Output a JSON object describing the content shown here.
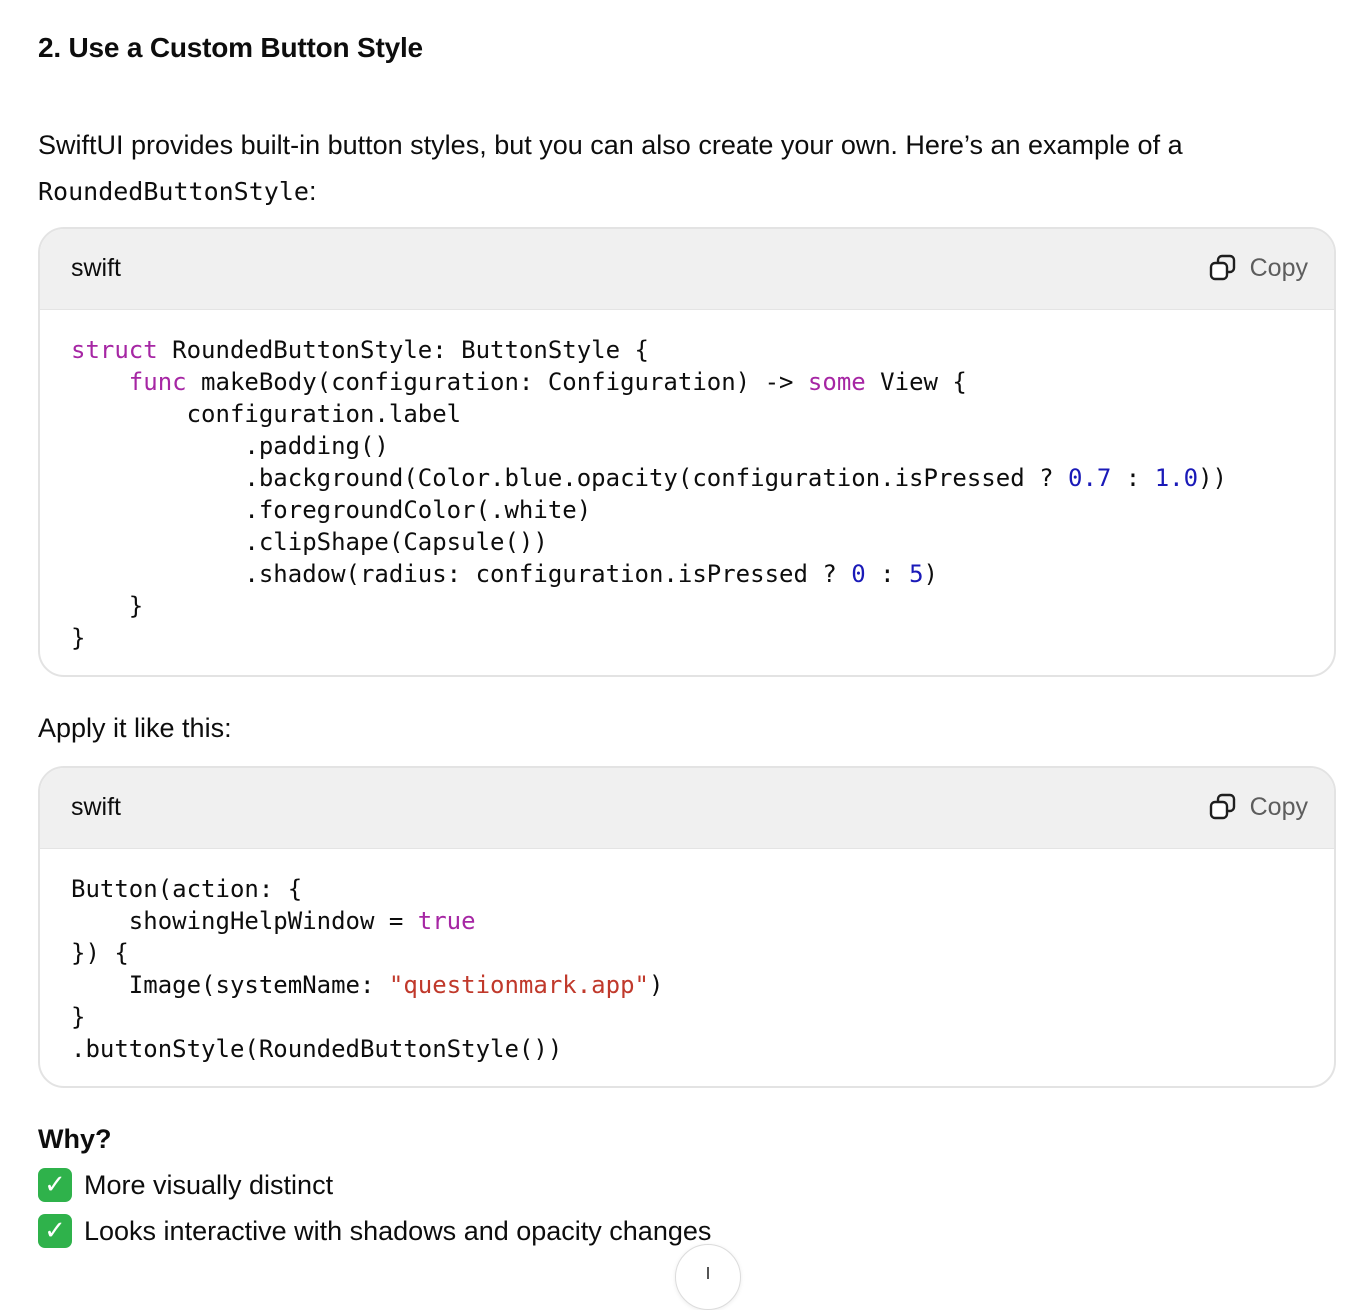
{
  "section": {
    "heading": "2. Use a Custom Button Style",
    "intro_text": "SwiftUI provides built-in button styles, but you can also create your own. Here’s an example of a ",
    "intro_code": "RoundedButtonStyle",
    "intro_suffix": ":"
  },
  "code_blocks": [
    {
      "language": "swift",
      "copy_label": "Copy",
      "lines": [
        [
          {
            "t": "struct",
            "c": "kw"
          },
          {
            "t": " RoundedButtonStyle: ButtonStyle {"
          }
        ],
        [
          {
            "t": "    "
          },
          {
            "t": "func",
            "c": "kw"
          },
          {
            "t": " makeBody(configuration: Configuration) -> "
          },
          {
            "t": "some",
            "c": "kw"
          },
          {
            "t": " View {"
          }
        ],
        [
          {
            "t": "        configuration.label"
          }
        ],
        [
          {
            "t": "            .padding()"
          }
        ],
        [
          {
            "t": "            .background(Color.blue.opacity(configuration.isPressed ? "
          },
          {
            "t": "0.7",
            "c": "num"
          },
          {
            "t": " : "
          },
          {
            "t": "1.0",
            "c": "num"
          },
          {
            "t": "))"
          }
        ],
        [
          {
            "t": "            .foregroundColor(.white)"
          }
        ],
        [
          {
            "t": "            .clipShape(Capsule())"
          }
        ],
        [
          {
            "t": "            .shadow(radius: configuration.isPressed ? "
          },
          {
            "t": "0",
            "c": "num"
          },
          {
            "t": " : "
          },
          {
            "t": "5",
            "c": "num"
          },
          {
            "t": ")"
          }
        ],
        [
          {
            "t": "    }"
          }
        ],
        [
          {
            "t": "}"
          }
        ]
      ]
    },
    {
      "language": "swift",
      "copy_label": "Copy",
      "lines": [
        [
          {
            "t": "Button(action: {"
          }
        ],
        [
          {
            "t": "    showingHelpWindow = "
          },
          {
            "t": "true",
            "c": "kw"
          }
        ],
        [
          {
            "t": "}) {"
          }
        ],
        [
          {
            "t": "    Image(systemName: "
          },
          {
            "t": "\"questionmark.app\"",
            "c": "str"
          },
          {
            "t": ")"
          }
        ],
        [
          {
            "t": "}"
          }
        ],
        [
          {
            "t": ".buttonStyle(RoundedButtonStyle())"
          }
        ]
      ]
    }
  ],
  "apply_text": "Apply it like this:",
  "why": {
    "title": "Why?",
    "items": [
      {
        "icon": "check-mark-icon",
        "text": "More visually distinct"
      },
      {
        "icon": "check-mark-icon",
        "text": "Looks interactive with shadows and opacity changes"
      }
    ]
  },
  "colors": {
    "keyword": "#a626a4",
    "number": "#1a1ab8",
    "string": "#c0392b",
    "check": "#2fb24b"
  }
}
